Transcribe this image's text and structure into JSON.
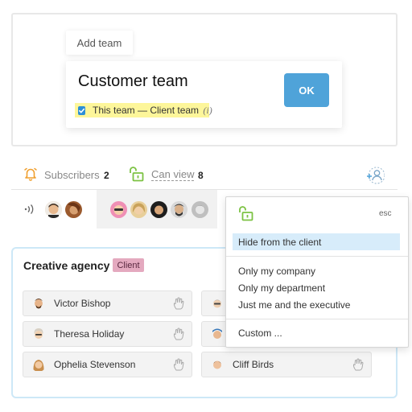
{
  "team_form": {
    "tab_label": "Add team",
    "team_name": "Customer team",
    "ok_label": "OK",
    "client_team_label": "This team — Client team",
    "client_team_info": "(i)",
    "client_team_checked": true
  },
  "subscribers_bar": {
    "subscribers_label": "Subscribers",
    "subscribers_count": "2",
    "can_view_label": "Can view",
    "can_view_count": "8"
  },
  "visibility_menu": {
    "esc_label": "esc",
    "items": [
      "Hide from the client",
      "Only my company",
      "Only my department",
      "Just me and the executive",
      "Custom ..."
    ],
    "selected": "Hide from the client"
  },
  "agency": {
    "title": "Creative agency",
    "badge": "Client",
    "people": [
      "Victor Bishop",
      "Theresa Holiday",
      "Ophelia Stevenson",
      "Cliff Birds"
    ]
  },
  "colors": {
    "ok_button": "#4fa3d9",
    "client_highlight": "#fdf69a",
    "client_badge": "#e4a9bf",
    "lock_green": "#7cc243",
    "bell_orange": "#f0a030",
    "selected_menu_bg": "#d7ecfa",
    "agency_border": "#cde8f7"
  }
}
